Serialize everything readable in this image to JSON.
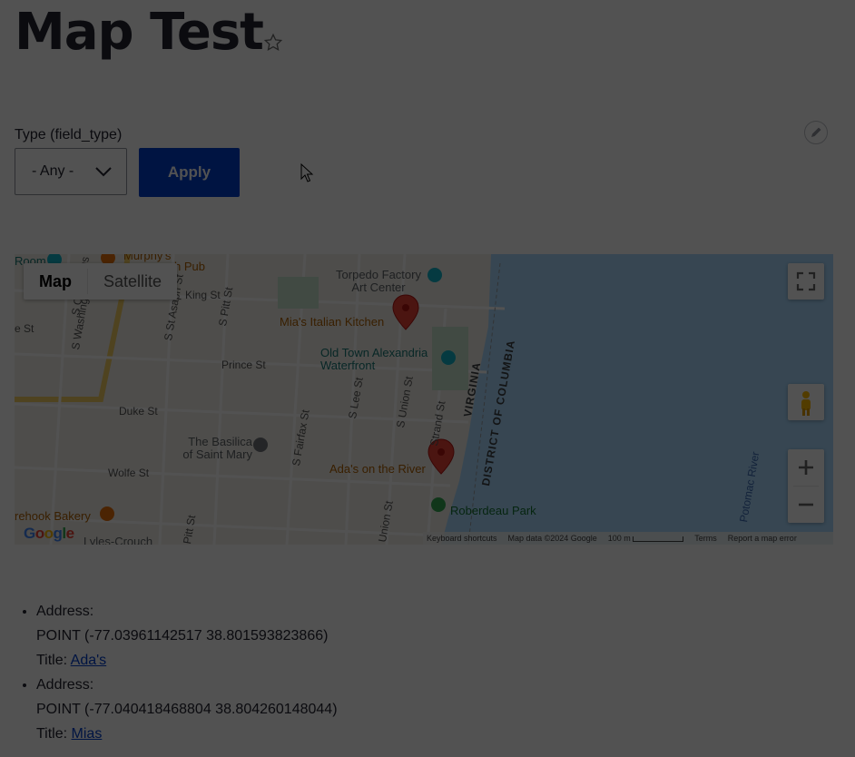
{
  "page": {
    "title": "Map Test",
    "star_icon": "star-outline-icon"
  },
  "filter": {
    "label": "Type (field_type)",
    "select_value": "- Any -",
    "apply_label": "Apply"
  },
  "map": {
    "type_controls": [
      "Map",
      "Satellite"
    ],
    "active_type": "Map",
    "labels": {
      "streets": [
        "King St",
        "Prince St",
        "Duke St",
        "Wolfe St",
        "S Washington St",
        "S St Asaph St",
        "S Pitt St",
        "S Fairfax St",
        "S Lee St",
        "S Union St",
        "Strand St",
        "S Columbus",
        "Pitt St",
        "Union St",
        "e St"
      ],
      "places": [
        "Torpedo Factory Art Center",
        "Mia's Italian Kitchen",
        "Old Town Alexandria Waterfront",
        "The Basilica of Saint Mary",
        "Ada's on the River",
        "Roberdeau Park",
        "rehook Bakery",
        "Lyles-Crouch",
        "Room",
        "Murphy's",
        "h Pub"
      ],
      "regions": [
        "VIRGINIA",
        "DISTRICT OF COLUMBIA"
      ],
      "water": [
        "Potomac River"
      ]
    },
    "attribution": {
      "shortcuts": "Keyboard shortcuts",
      "data": "Map data ©2024 Google",
      "scale": "100 m",
      "terms": "Terms",
      "report": "Report a map error"
    },
    "logo": "Google"
  },
  "results": [
    {
      "address_label": "Address:",
      "point": "POINT (-77.03961142517 38.801593823866)",
      "title_label": "Title:",
      "title_link": "Ada's"
    },
    {
      "address_label": "Address:",
      "point": "POINT (-77.040418468804 38.804260148044)",
      "title_label": "Title:",
      "title_link": "Mias"
    }
  ],
  "colors": {
    "primary": "#003ecc",
    "text": "#222330",
    "overlay": "rgba(0,0,0,0.68)",
    "marker": "#ea4335",
    "water": "#aadaff"
  }
}
